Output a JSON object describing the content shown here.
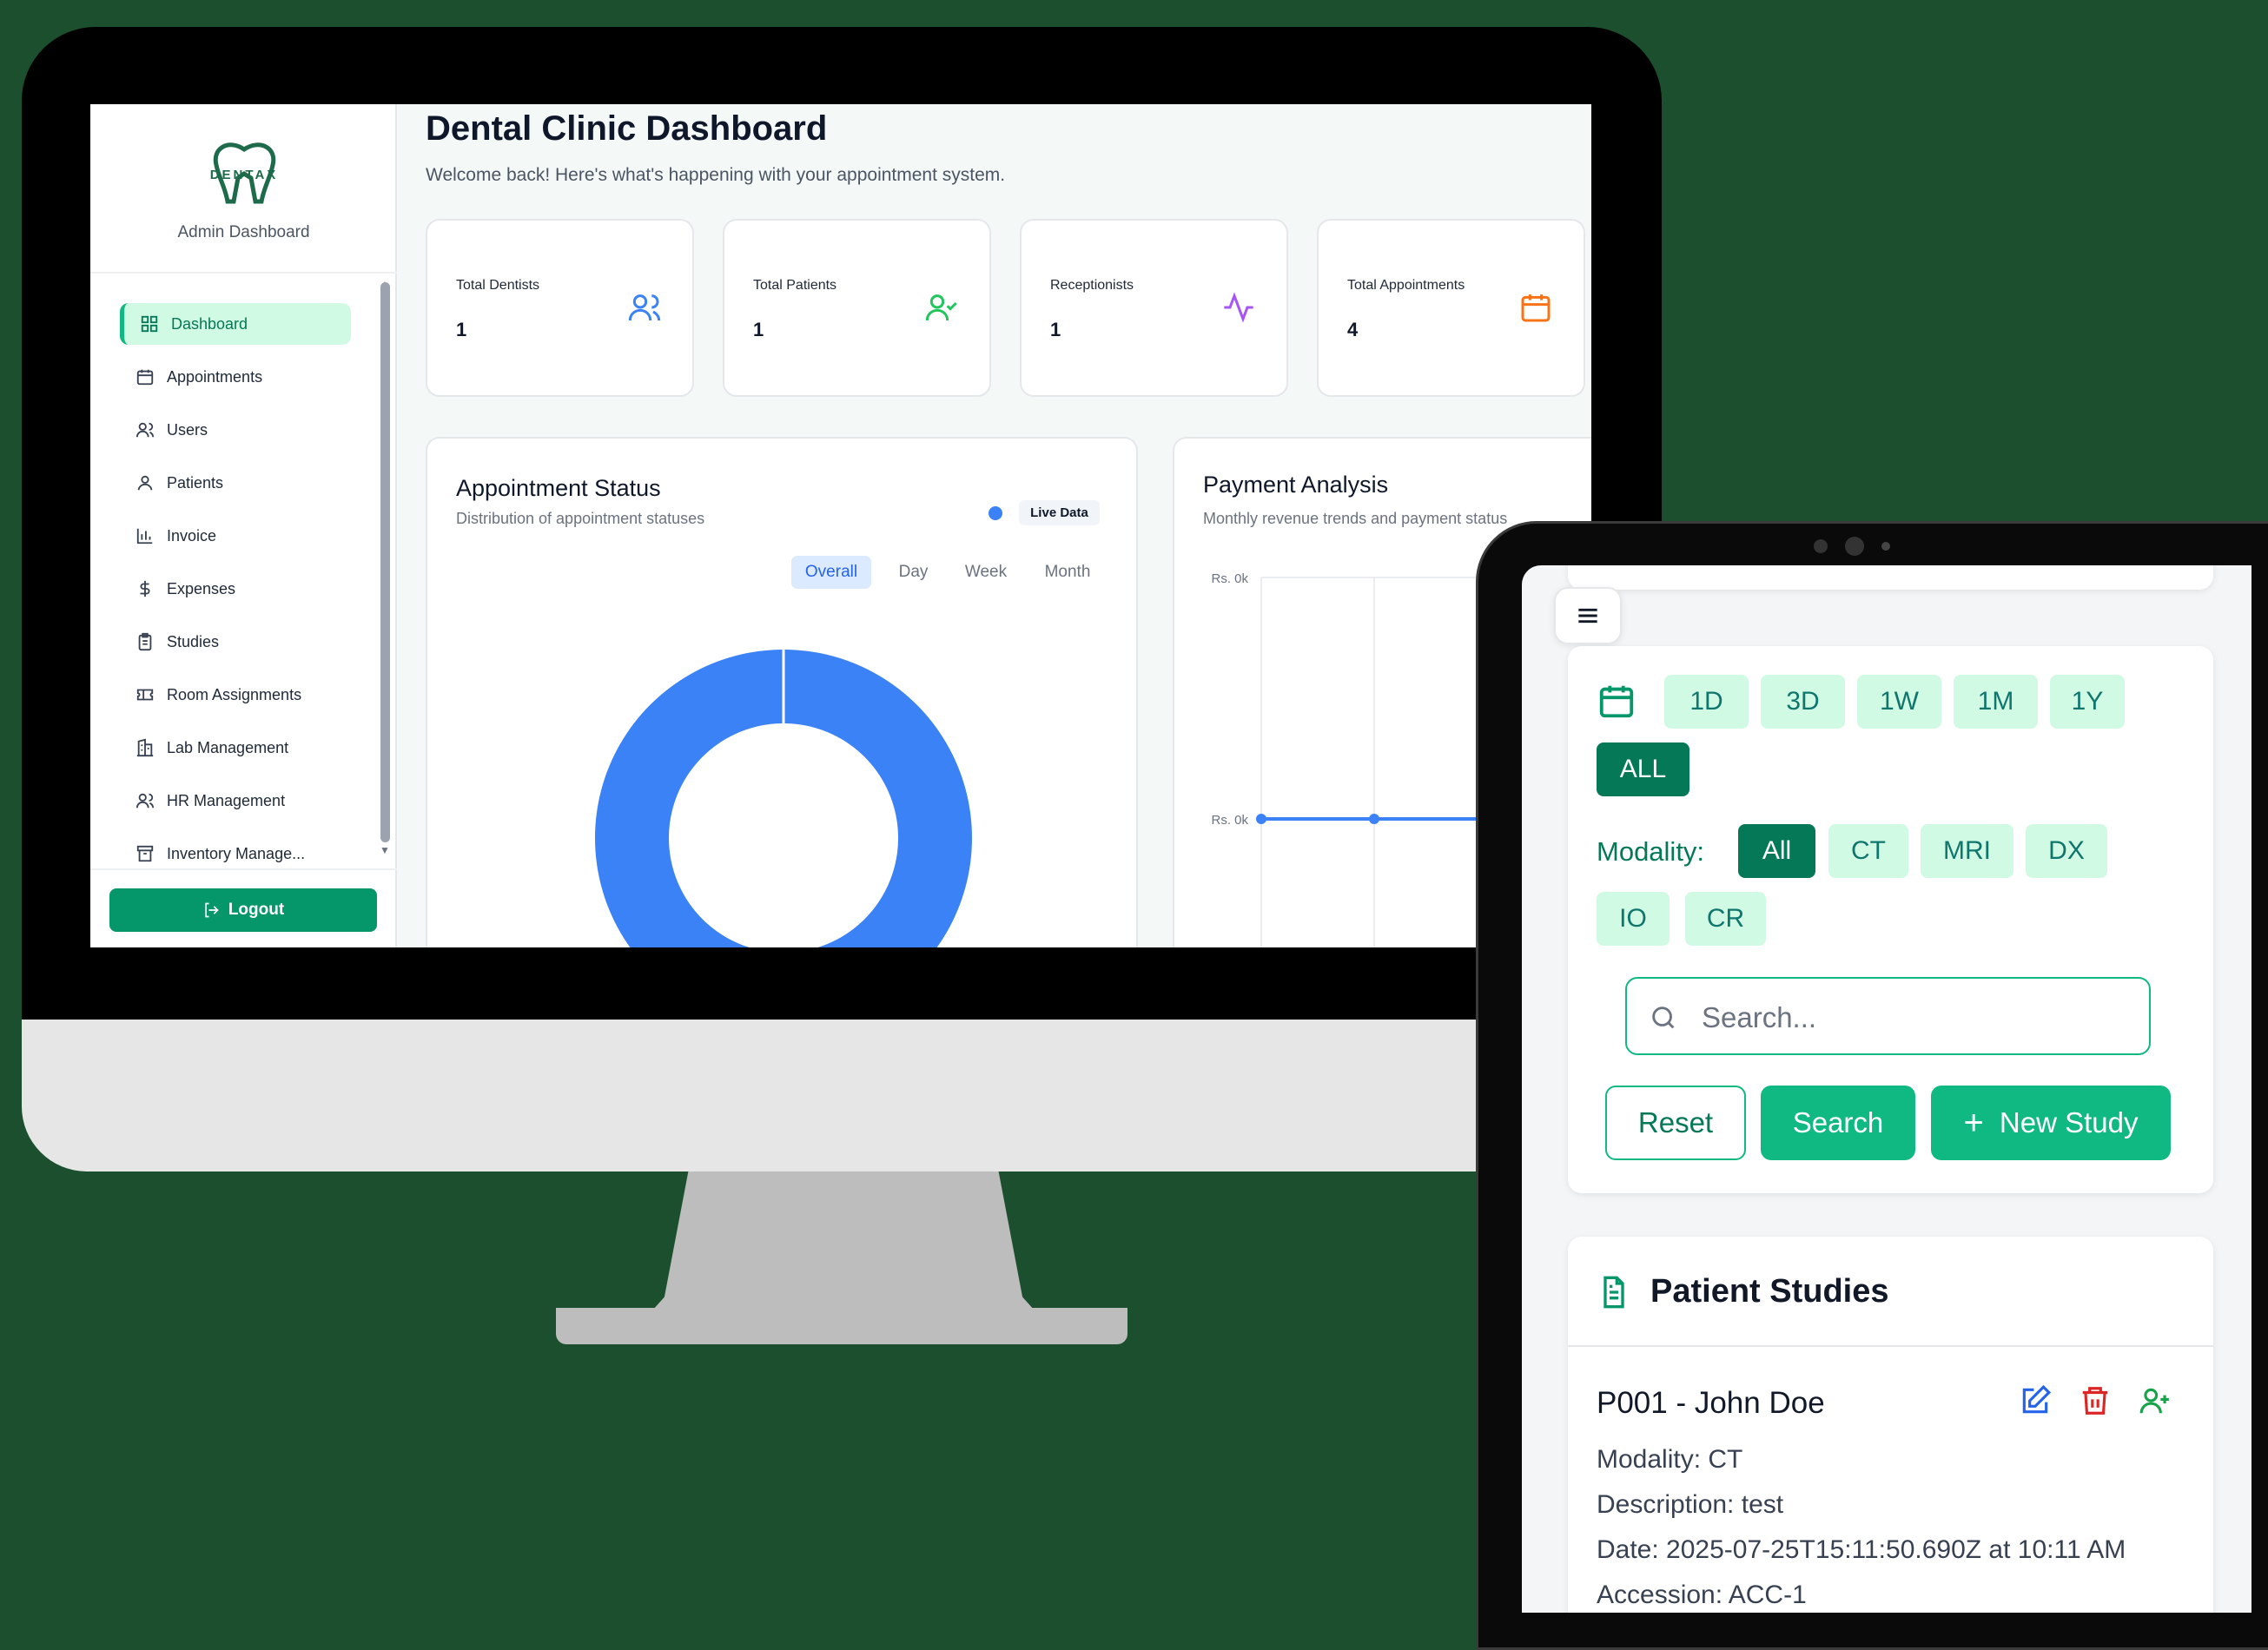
{
  "desktop": {
    "logo_text": "DENTAX",
    "admin_label": "Admin Dashboard",
    "nav": [
      {
        "label": "Dashboard",
        "icon": "dashboard-grid-icon",
        "active": true
      },
      {
        "label": "Appointments",
        "icon": "calendar-icon"
      },
      {
        "label": "Users",
        "icon": "users-icon"
      },
      {
        "label": "Patients",
        "icon": "user-icon"
      },
      {
        "label": "Invoice",
        "icon": "bar-chart-icon"
      },
      {
        "label": "Expenses",
        "icon": "dollar-icon"
      },
      {
        "label": "Studies",
        "icon": "clipboard-icon"
      },
      {
        "label": "Room Assignments",
        "icon": "ticket-icon"
      },
      {
        "label": "Lab Management",
        "icon": "building-icon"
      },
      {
        "label": "HR Management",
        "icon": "users-icon"
      },
      {
        "label": "Inventory Manage...",
        "icon": "archive-icon"
      }
    ],
    "logout_label": "Logout",
    "page_title": "Dental Clinic Dashboard",
    "page_subtitle": "Welcome back! Here's what's happening with your appointment system.",
    "stats": [
      {
        "label": "Total Dentists",
        "value": "1",
        "icon": "users-icon",
        "color": "#3b82f6"
      },
      {
        "label": "Total Patients",
        "value": "1",
        "icon": "user-check-icon",
        "color": "#22c55e"
      },
      {
        "label": "Receptionists",
        "value": "1",
        "icon": "activity-icon",
        "color": "#a855f7"
      },
      {
        "label": "Total Appointments",
        "value": "4",
        "icon": "calendar-icon",
        "color": "#f97316"
      }
    ],
    "appointment_status": {
      "title": "Appointment Status",
      "subtitle": "Distribution of appointment statuses",
      "live_label": "Live Data",
      "tabs": [
        "Overall",
        "Day",
        "Week",
        "Month"
      ],
      "active_tab": "Overall"
    },
    "payment_analysis": {
      "title": "Payment Analysis",
      "subtitle": "Monthly revenue trends and payment status"
    }
  },
  "chart_data": [
    {
      "type": "pie",
      "categories": [
        ""
      ],
      "values": [
        100
      ],
      "colors": [
        "#3b82f6"
      ]
    },
    {
      "type": "line",
      "y_tick_labels": [
        "Rs. 0k",
        "Rs. 0k"
      ],
      "x": [
        0,
        1,
        2
      ],
      "series": [
        {
          "values": [
            0,
            0,
            0
          ]
        }
      ],
      "color": "#3b82f6"
    }
  ],
  "tablet": {
    "menu_icon": "hamburger-icon",
    "date_filters": [
      "1D",
      "3D",
      "1W",
      "1M",
      "1Y",
      "ALL"
    ],
    "active_date_filter": "ALL",
    "modality_label": "Modality:",
    "modalities": [
      "All",
      "CT",
      "MRI",
      "DX",
      "IO",
      "CR"
    ],
    "active_modality": "All",
    "search_placeholder": "Search...",
    "reset_label": "Reset",
    "search_label": "Search",
    "new_study_label": "New Study",
    "studies_title": "Patient Studies",
    "study": {
      "title": "P001 - John Doe",
      "modality": "Modality: CT",
      "description": "Description: test",
      "date": "Date: 2025-07-25T15:11:50.690Z at 10:11 AM",
      "accession": "Accession: ACC-1"
    },
    "colors": {
      "accent": "#10b981",
      "accent_dark": "#047857",
      "chip_bg": "#d1fae5"
    }
  }
}
